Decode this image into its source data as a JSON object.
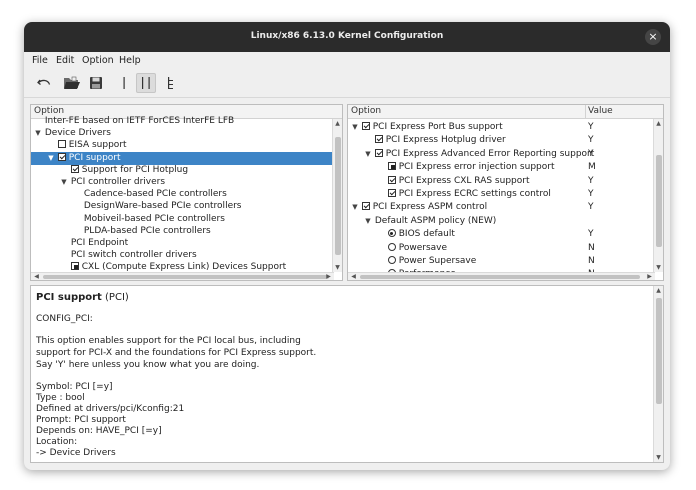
{
  "window": {
    "title": "Linux/x86 6.13.0 Kernel Configuration"
  },
  "menu": {
    "file": "File",
    "edit": "Edit",
    "option": "Option",
    "help": "Help"
  },
  "toolbar": {
    "back_icon": "undo-arrow-icon",
    "open_icon": "folder-open-icon",
    "save_icon": "floppy-disk-icon",
    "single_view_icon": "single-view-icon",
    "split_view_icon": "split-view-icon",
    "full_view_icon": "full-view-icon"
  },
  "left_pane": {
    "header": "Option",
    "rows": [
      {
        "label": "Inter-FE based on IETF ForCES InterFE LFB",
        "indent": 0,
        "control": "none",
        "expander": ""
      },
      {
        "label": "Device Drivers",
        "indent": 0,
        "control": "none",
        "expander": "expanded"
      },
      {
        "label": "EISA support",
        "indent": 1,
        "control": "checkbox",
        "checked": false,
        "expander": ""
      },
      {
        "label": "PCI support",
        "indent": 1,
        "control": "checkbox",
        "checked": true,
        "expander": "expanded",
        "selected": true
      },
      {
        "label": "Support for PCI Hotplug",
        "indent": 2,
        "control": "checkbox",
        "checked": true,
        "expander": ""
      },
      {
        "label": "PCI controller drivers",
        "indent": 2,
        "control": "none",
        "expander": "expanded"
      },
      {
        "label": "Cadence-based PCIe controllers",
        "indent": 3,
        "control": "none",
        "expander": ""
      },
      {
        "label": "DesignWare-based PCIe controllers",
        "indent": 3,
        "control": "none",
        "expander": ""
      },
      {
        "label": "Mobiveil-based PCIe controllers",
        "indent": 3,
        "control": "none",
        "expander": ""
      },
      {
        "label": "PLDA-based PCIe controllers",
        "indent": 3,
        "control": "none",
        "expander": ""
      },
      {
        "label": "PCI Endpoint",
        "indent": 2,
        "control": "none",
        "expander": ""
      },
      {
        "label": "PCI switch controller drivers",
        "indent": 2,
        "control": "none",
        "expander": ""
      },
      {
        "label": "CXL (Compute Express Link) Devices Support",
        "indent": 2,
        "control": "checkbox",
        "checked": "module",
        "expander": ""
      }
    ]
  },
  "right_pane": {
    "header_option": "Option",
    "header_value": "Value",
    "rows": [
      {
        "label": "PCI Express Port Bus support",
        "indent": 0,
        "control": "checkbox",
        "checked": true,
        "expander": "expanded",
        "value": "Y"
      },
      {
        "label": "PCI Express Hotplug driver",
        "indent": 1,
        "control": "checkbox",
        "checked": true,
        "expander": "",
        "value": "Y"
      },
      {
        "label": "PCI Express Advanced Error Reporting support",
        "indent": 1,
        "control": "checkbox",
        "checked": true,
        "expander": "expanded",
        "value": "Y"
      },
      {
        "label": "PCI Express error injection support",
        "indent": 2,
        "control": "checkbox",
        "checked": "module",
        "expander": "",
        "value": "M"
      },
      {
        "label": "PCI Express CXL RAS support",
        "indent": 2,
        "control": "checkbox",
        "checked": true,
        "expander": "",
        "value": "Y"
      },
      {
        "label": "PCI Express ECRC settings control",
        "indent": 2,
        "control": "checkbox",
        "checked": true,
        "expander": "",
        "value": "Y"
      },
      {
        "label": "PCI Express ASPM control",
        "indent": 0,
        "control": "checkbox",
        "checked": true,
        "expander": "expanded",
        "value": "Y"
      },
      {
        "label": "Default ASPM policy (NEW)",
        "indent": 1,
        "control": "none",
        "expander": "expanded",
        "value": ""
      },
      {
        "label": "BIOS default",
        "indent": 2,
        "control": "radio",
        "checked": true,
        "expander": "",
        "value": "Y"
      },
      {
        "label": "Powersave",
        "indent": 2,
        "control": "radio",
        "checked": false,
        "expander": "",
        "value": "N"
      },
      {
        "label": "Power Supersave",
        "indent": 2,
        "control": "radio",
        "checked": false,
        "expander": "",
        "value": "N"
      },
      {
        "label": "Performance",
        "indent": 2,
        "control": "radio",
        "checked": false,
        "expander": "",
        "value": "N"
      }
    ]
  },
  "help": {
    "title": "PCI support",
    "title_suffix": "(PCI)",
    "symbol_line": "CONFIG_PCI:",
    "desc1": "This option enables support for the PCI local bus, including",
    "desc2": "support for PCI-X and the foundations for PCI Express support.",
    "desc3": "Say 'Y' here unless you know what you are doing.",
    "symbol": "Symbol: PCI [=y]",
    "type": "Type : bool",
    "defined": "Defined at drivers/pci/Kconfig:21",
    "prompt": "Prompt: PCI support",
    "depends": "Depends on: HAVE_PCI [=y]",
    "location": "Location:",
    "location_path": "-> Device Drivers"
  }
}
